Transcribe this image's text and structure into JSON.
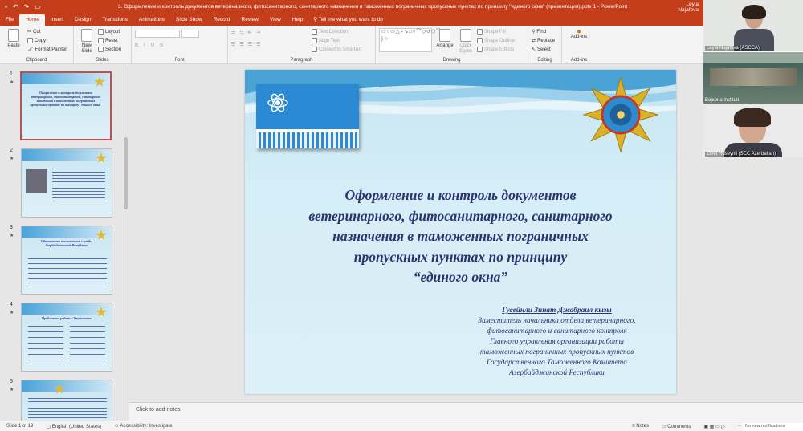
{
  "app": {
    "title": "3. Оформление и контроль документов ветеринарного, фитосанитарного, санитарного назначения в таможенных пограничных пропускных пунктах по принципу \"единого окна\" (презентация).pptx 1 - PowerPoint",
    "user": "Leyla Najafova"
  },
  "tabs": [
    "File",
    "Home",
    "Insert",
    "Design",
    "Transitions",
    "Animations",
    "Slide Show",
    "Record",
    "Review",
    "View",
    "Help"
  ],
  "tellme": "Tell me what you want to do",
  "ribbon": {
    "clipboard": {
      "label": "Clipboard",
      "paste": "Paste",
      "cut": "Cut",
      "copy": "Copy",
      "format_painter": "Format Painter"
    },
    "slides": {
      "label": "Slides",
      "new_slide": "New Slide",
      "layout": "Layout",
      "reset": "Reset",
      "section": "Section"
    },
    "font": {
      "label": "Font"
    },
    "paragraph": {
      "label": "Paragraph",
      "text_direction": "Text Direction",
      "align_text": "Align Text",
      "convert": "Convert to SmartArt"
    },
    "drawing": {
      "label": "Drawing",
      "arrange": "Arrange",
      "quick_styles": "Quick Styles",
      "shape_fill": "Shape Fill",
      "shape_outline": "Shape Outline",
      "shape_effects": "Shape Effects"
    },
    "editing": {
      "label": "Editing",
      "find": "Find",
      "replace": "Replace",
      "select": "Select"
    },
    "addins": {
      "label": "Add-ins",
      "btn": "Add-ins"
    }
  },
  "thumbnails": [
    {
      "num": "1",
      "star": "★",
      "title": "Оформление и контроль документов ветеринарного, фитосанитарного, санитарного назначения в таможенных пограничных пропускных пунктах по принципу \"единого окна\""
    },
    {
      "num": "2",
      "star": "★",
      "title": ""
    },
    {
      "num": "3",
      "star": "★",
      "title": "Обязанности таможенной службы Азербайджанской Республики"
    },
    {
      "num": "4",
      "star": "★",
      "title": "Проблемные работы / Результаты"
    },
    {
      "num": "5",
      "star": "★",
      "title": ""
    }
  ],
  "slide": {
    "title_lines": [
      "Оформление и контроль документов",
      "ветеринарного, фитосанитарного, санитарного",
      "назначения в таможенных пограничных",
      "пропускных пунктах по принципу",
      "“единого окна”"
    ],
    "author_name": "Гусейнли Зинат Джабраил кызы",
    "author_lines": [
      "Заместитель начальника отдела ветеринарного,",
      "фитосанитарного и санитарного контроля",
      "Главного управления организации работы",
      "таможенных пограничных пропускных пунктов",
      "Государственного Таможенного Комитета",
      "Азербайджанской Республики"
    ]
  },
  "notes": "Click to add notes",
  "status": {
    "slide": "Slide 1 of 19",
    "language": "English (United States)",
    "accessibility": "Accessibility: Investigate",
    "notes": "Notes",
    "comments": "Comments"
  },
  "participants": [
    "Leyla Najafova (ASCCA)",
    "Bojxona instituti",
    "Zinet Huseynli (SCC Azerbaijan)"
  ],
  "notification": "No new notifications"
}
